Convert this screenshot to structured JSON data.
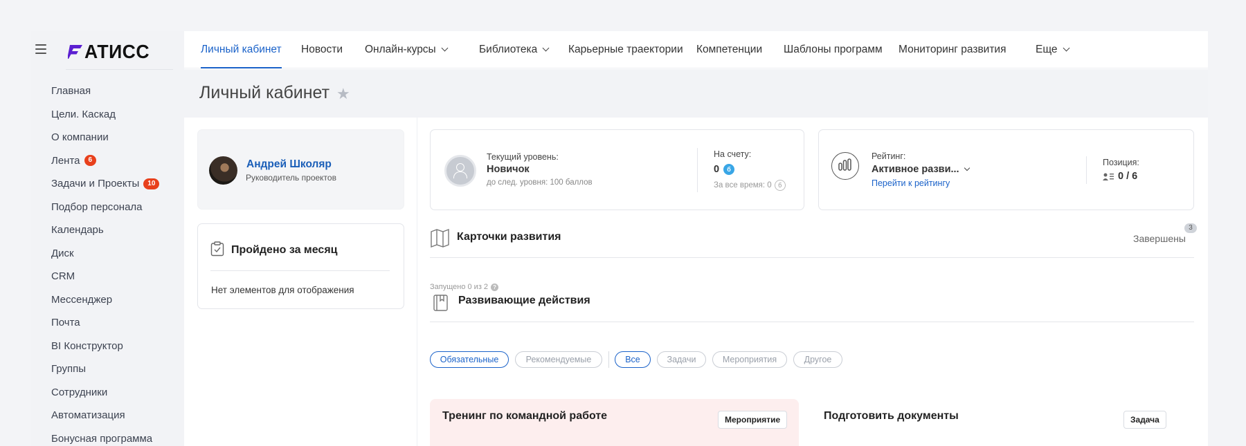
{
  "brand": {
    "logo_text": "АТИСС",
    "accent": "#1a62c9",
    "logo_color": "#5b1fd1"
  },
  "sidebar": {
    "items": [
      {
        "label": "Главная"
      },
      {
        "label": "Цели. Каскад"
      },
      {
        "label": "О компании"
      },
      {
        "label": "Лента",
        "badge": "6"
      },
      {
        "label": "Задачи и Проекты",
        "badge": "10"
      },
      {
        "label": "Подбор персонала"
      },
      {
        "label": "Календарь"
      },
      {
        "label": "Диск"
      },
      {
        "label": "CRM"
      },
      {
        "label": "Мессенджер"
      },
      {
        "label": "Почта"
      },
      {
        "label": "BI Конструктор"
      },
      {
        "label": "Группы"
      },
      {
        "label": "Сотрудники"
      },
      {
        "label": "Автоматизация"
      },
      {
        "label": "Бонусная программа"
      }
    ]
  },
  "topnav": {
    "tabs": [
      {
        "label": "Личный кабинет",
        "active": true
      },
      {
        "label": "Новости"
      },
      {
        "label": "Онлайн-курсы"
      },
      {
        "label": "Библиотека"
      },
      {
        "label": "Карьерные траектории"
      },
      {
        "label": "Компетенции"
      },
      {
        "label": "Шаблоны программ"
      },
      {
        "label": "Мониторинг развития"
      },
      {
        "label": "Еще"
      }
    ]
  },
  "page": {
    "title": "Личный кабинет"
  },
  "profile": {
    "name": "Андрей Школяр",
    "role": "Руководитель проектов"
  },
  "month": {
    "title": "Пройдено за месяц",
    "empty": "Нет элементов для отображения"
  },
  "level": {
    "label": "Текущий уровень:",
    "value": "Новичок",
    "next": "до след. уровня: 100 баллов",
    "account_label": "На счету:",
    "account_value": "0",
    "coin": "б",
    "alltime": "За все время: 0"
  },
  "rating": {
    "label": "Рейтинг:",
    "value": "Активное разви...",
    "link": "Перейти к рейтингу",
    "position_label": "Позиция:",
    "position_value": "0 / 6"
  },
  "cards": {
    "title": "Карточки развития",
    "completed_label": "Завершены",
    "completed_count": "3"
  },
  "actions": {
    "launched": "Запущено 0 из 2",
    "title": "Развивающие действия"
  },
  "filters": {
    "items": [
      "Обязательные",
      "Рекомендуемые",
      "Все",
      "Задачи",
      "Мероприятия",
      "Другое"
    ]
  },
  "tasks": [
    {
      "title": "Тренинг по командной работе",
      "tag": "Мероприятие",
      "bg": "#fdeeee"
    },
    {
      "title": "Подготовить документы",
      "tag": "Задача",
      "bg": "#ffffff"
    }
  ]
}
